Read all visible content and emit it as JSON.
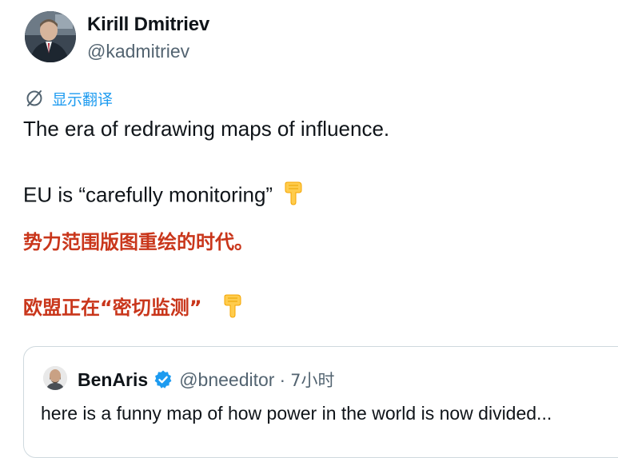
{
  "author": {
    "name": "Kirill Dmitriev",
    "handle": "@kadmitriev"
  },
  "translate": {
    "label": "显示翻译",
    "icon": "translate-icon",
    "color": "#1d9bf0"
  },
  "tweet": {
    "line1": "The era of redrawing maps of influence.",
    "line2": "EU is “carefully monitoring”",
    "emoji": "backhand-index-pointing-down",
    "zh_line1": "势力范围版图重绘的时代。",
    "zh_line2": "欧盟正在“密切监测”",
    "zh_color": "#c9361b"
  },
  "quoted": {
    "name": "BenAris",
    "verified": true,
    "handle": "@bneeditor",
    "dot": "·",
    "time": "7小时",
    "text": "here is a funny map of how power in the world is now divided..."
  },
  "colors": {
    "text": "#0f1419",
    "secondary": "#536471",
    "accent": "#1d9bf0",
    "border": "#cfd9de"
  }
}
